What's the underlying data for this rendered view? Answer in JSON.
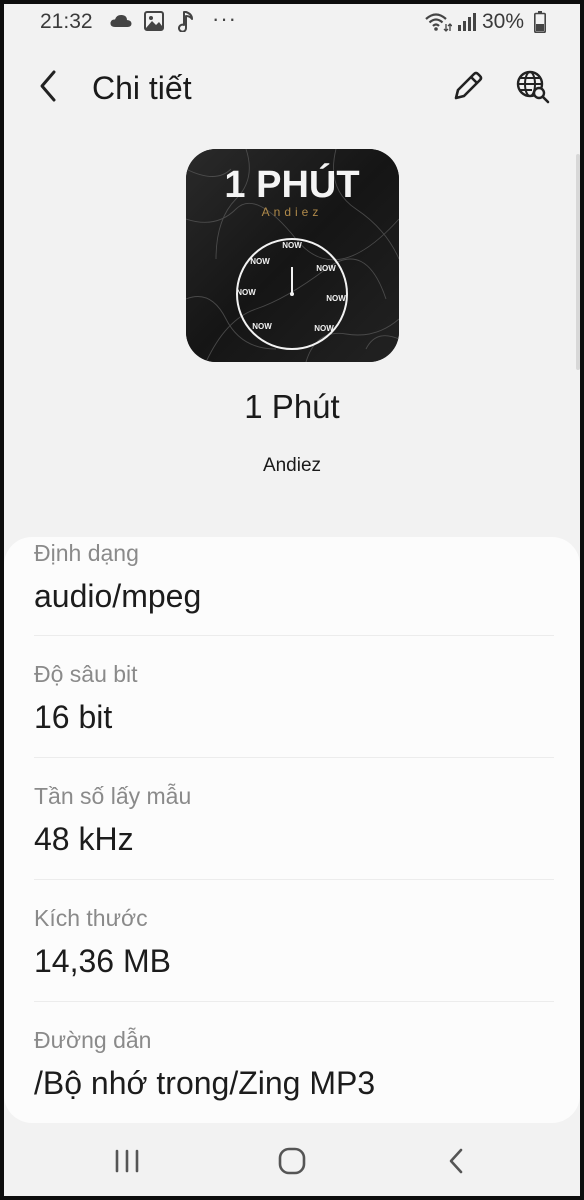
{
  "status_bar": {
    "time": "21:32",
    "icons": [
      "cloud-icon",
      "image-icon",
      "music-note-icon",
      "more-icon",
      "wifi-icon",
      "signal-icon",
      "battery-icon"
    ],
    "more": "···",
    "battery_percent": "30%"
  },
  "app_bar": {
    "title": "Chi tiết",
    "icons": [
      "back-arrow-icon",
      "edit-pencil-icon",
      "web-search-icon"
    ]
  },
  "album_art": {
    "title_text": "1 PHÚT",
    "subtitle_text": "Andiez",
    "clock_labels": [
      "NOW",
      "NOW",
      "NOW",
      "NOW",
      "NOW",
      "NOW",
      "NOW"
    ]
  },
  "song": {
    "title": "1 Phút",
    "artist": "Andiez"
  },
  "details": [
    {
      "label": "Định dạng",
      "value": "audio/mpeg"
    },
    {
      "label": "Độ sâu bit",
      "value": "16 bit"
    },
    {
      "label": "Tần số lấy mẫu",
      "value": "48 kHz"
    },
    {
      "label": "Kích thước",
      "value": "14,36 MB"
    },
    {
      "label": "Đường dẫn",
      "value": "/Bộ nhớ trong/Zing MP3"
    }
  ],
  "nav_bar": {
    "icons": [
      "recent-apps-icon",
      "home-icon",
      "back-icon"
    ]
  },
  "colors": {
    "background": "#f2f2f2",
    "card": "#fcfcfc",
    "label": "#8a8a8a",
    "text": "#1a1a1a"
  }
}
